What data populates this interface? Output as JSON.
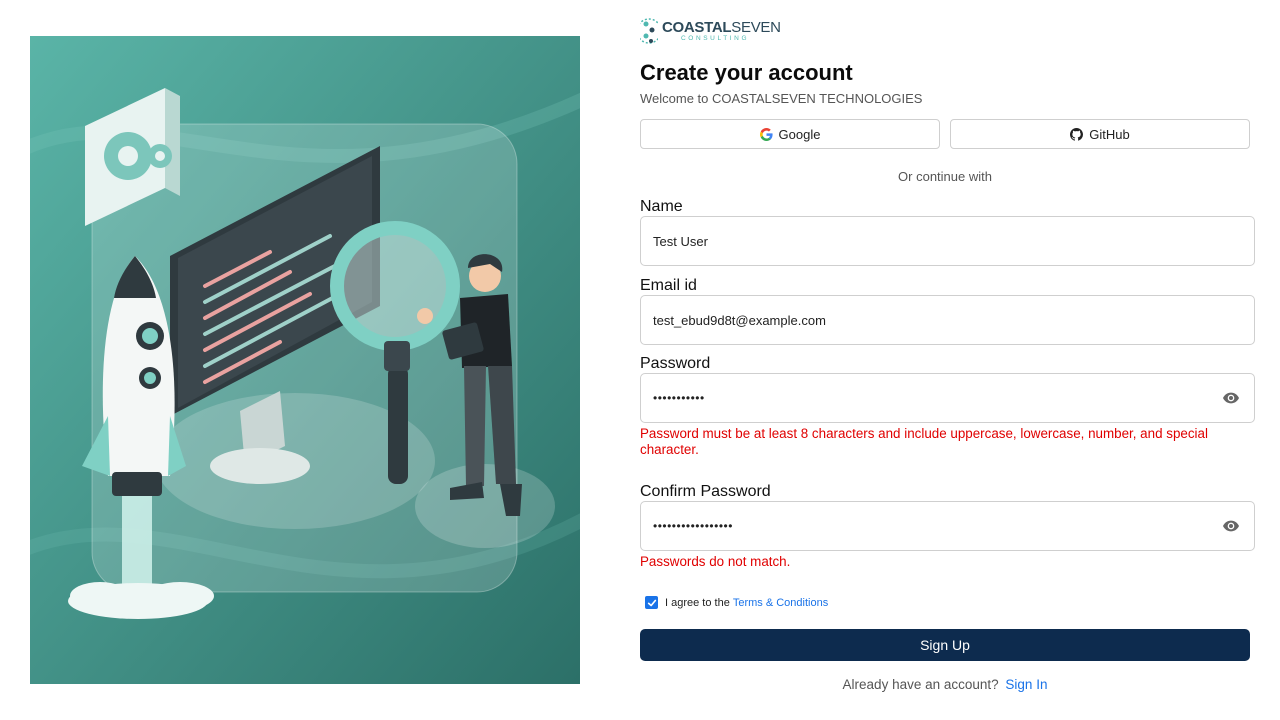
{
  "brand": {
    "name_bold": "COASTAL",
    "name_regular": "SEVEN",
    "tagline": "CONSULTING"
  },
  "header": {
    "title": "Create your account",
    "subtitle": "Welcome to COASTALSEVEN TECHNOLOGIES"
  },
  "oauth": {
    "google_label": "Google",
    "github_label": "GitHub",
    "divider": "Or continue with"
  },
  "fields": {
    "name": {
      "label": "Name",
      "value": "Test User"
    },
    "email": {
      "label": "Email id",
      "value": "test_ebud9d8t@example.com"
    },
    "password": {
      "label": "Password",
      "value": "•••••••••••",
      "error": "Password must be at least 8 characters and include uppercase, lowercase, number, and special character."
    },
    "confirm_password": {
      "label": "Confirm Password",
      "value": "•••••••••••••••••",
      "error": "Passwords do not match."
    }
  },
  "terms": {
    "checked": true,
    "prefix": "I agree to the",
    "link": "Terms & Conditions"
  },
  "actions": {
    "signup_label": "Sign Up",
    "signin_prefix": "Already have an account?",
    "signin_link": "Sign In"
  },
  "colors": {
    "primary_button": "#0d2b4e",
    "link": "#1a73e8",
    "error": "#e00000",
    "illustration_bg": "#3f9a8f"
  }
}
